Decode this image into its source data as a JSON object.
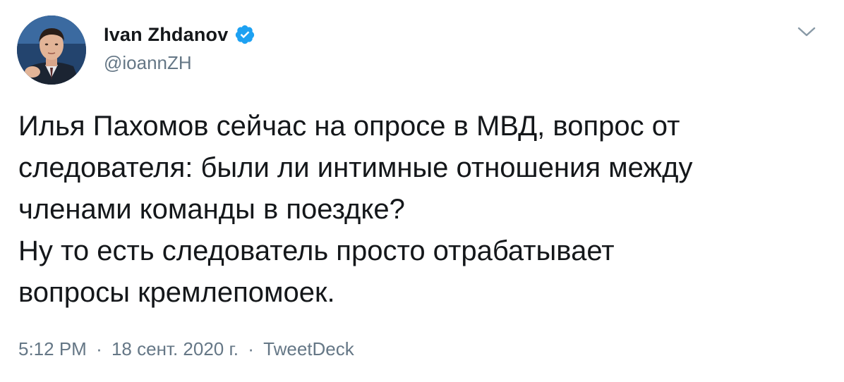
{
  "author": {
    "display_name": "Ivan Zhdanov",
    "handle": "@ioannZH",
    "verified": true
  },
  "icons": {
    "verified": "verified-badge-icon",
    "menu": "chevron-down-icon"
  },
  "tweet": {
    "lines": [
      "Илья Пахомов сейчас на опросе в МВД, вопрос от",
      "следователя: были ли интимные отношения между",
      "членами команды в поездке?",
      "Ну то есть следователь просто отрабатывает",
      "вопросы кремлепомоек."
    ]
  },
  "meta": {
    "time": "5:12 PM",
    "separator": "·",
    "date": "18 сент. 2020 г.",
    "source": "TweetDeck"
  },
  "colors": {
    "text": "#14171a",
    "secondary": "#657786",
    "verified": "#1da1f2"
  }
}
